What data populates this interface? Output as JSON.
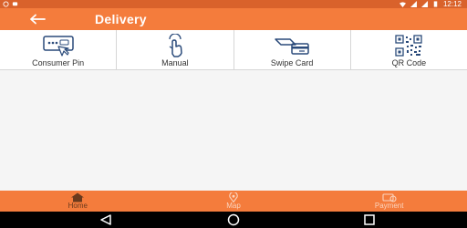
{
  "status_bar": {
    "time": "12:12",
    "icons": [
      "whatsapp-icon",
      "chat-icon",
      "wifi-icon",
      "signal-r-icon",
      "signal-icon",
      "battery-icon"
    ]
  },
  "app_bar": {
    "title": "Delivery",
    "back_icon": "arrow-left-icon",
    "color": "#f47c3c"
  },
  "options": [
    {
      "label": "Consumer Pin",
      "icon": "pin-pad-icon"
    },
    {
      "label": "Manual",
      "icon": "tap-hand-icon"
    },
    {
      "label": "Swipe Card",
      "icon": "swipe-card-icon"
    },
    {
      "label": "QR Code",
      "icon": "qr-code-icon"
    }
  ],
  "bottom_nav": [
    {
      "label": "Home",
      "icon": "home-icon",
      "active": true
    },
    {
      "label": "Map",
      "icon": "map-pin-icon",
      "active": false
    },
    {
      "label": "Payment",
      "icon": "payment-icon",
      "active": false
    }
  ],
  "system_nav": [
    "back-triangle-icon",
    "home-circle-icon",
    "recents-square-icon"
  ]
}
